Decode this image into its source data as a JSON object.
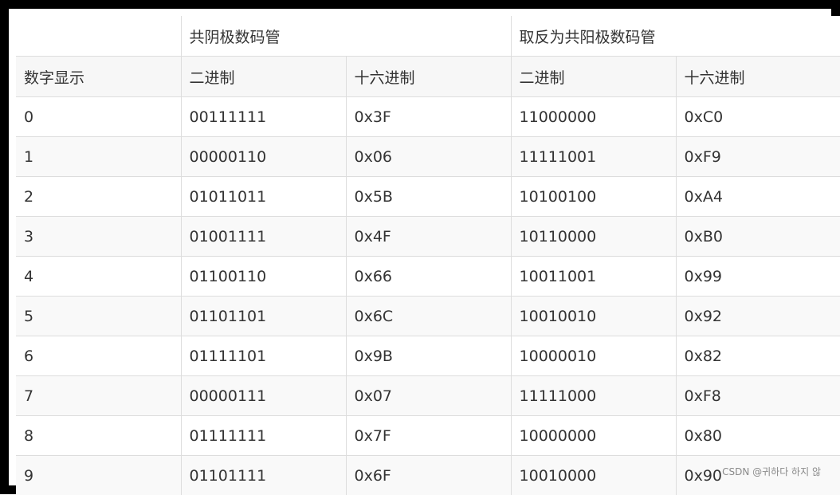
{
  "table": {
    "group_headers": [
      "",
      "共阴极数码管",
      "取反为共阳极数码管"
    ],
    "sub_headers": [
      "数字显示",
      "二进制",
      "十六进制",
      "二进制",
      "十六进制"
    ],
    "rows": [
      [
        "0",
        "00111111",
        "0x3F",
        "11000000",
        "0xC0"
      ],
      [
        "1",
        "00000110",
        "0x06",
        "11111001",
        "0xF9"
      ],
      [
        "2",
        "01011011",
        "0x5B",
        "10100100",
        "0xA4"
      ],
      [
        "3",
        "01001111",
        "0x4F",
        "10110000",
        "0xB0"
      ],
      [
        "4",
        "01100110",
        "0x66",
        "10011001",
        "0x99"
      ],
      [
        "5",
        "01101101",
        "0x6C",
        "10010010",
        "0x92"
      ],
      [
        "6",
        "01111101",
        "0x9B",
        "10000010",
        "0x82"
      ],
      [
        "7",
        "00000111",
        "0x07",
        "11111000",
        "0xF8"
      ],
      [
        "8",
        "01111111",
        "0x7F",
        "10000000",
        "0x80"
      ],
      [
        "9",
        "01101111",
        "0x6F",
        "10010000",
        "0x90"
      ]
    ]
  },
  "watermark": "CSDN @귀하다 하지 않"
}
